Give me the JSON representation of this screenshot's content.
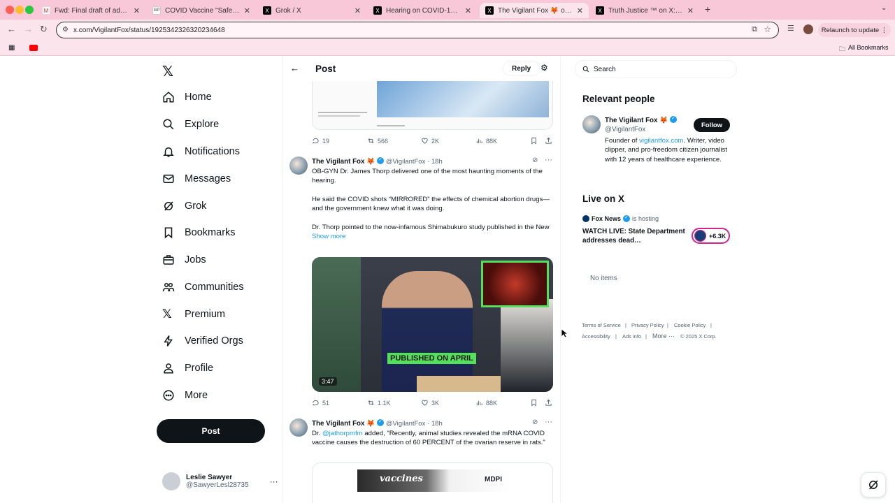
{
  "browser": {
    "tabs": [
      {
        "label": "Fwd: Final draft of advertisem",
        "icon": "gmail-icon"
      },
      {
        "label": "COVID Vaccine \"Safe and Effe",
        "icon": "gp-icon"
      },
      {
        "label": "Grok / X",
        "icon": "x-icon"
      },
      {
        "label": "Hearing on COVID-19 Vaccin",
        "icon": "x-icon"
      },
      {
        "label": "The Vigilant Fox 🦊 on X: \"Se",
        "icon": "x-icon"
      },
      {
        "label": "Truth Justice ™ on X: \"@Pete",
        "icon": "x-icon"
      }
    ],
    "url": "x.com/VigilantFox/status/1925342326320234648",
    "relaunch": "Relaunch to update",
    "all_bookmarks": "All Bookmarks"
  },
  "nav": {
    "items": [
      "Home",
      "Explore",
      "Notifications",
      "Messages",
      "Grok",
      "Bookmarks",
      "Jobs",
      "Communities",
      "Premium",
      "Verified Orgs",
      "Profile",
      "More"
    ],
    "post_button": "Post",
    "account": {
      "name": "Leslie Sawyer",
      "handle": "@SawyerLesl28735"
    }
  },
  "main": {
    "title": "Post",
    "reply": "Reply",
    "top_actions": {
      "replies": "19",
      "reposts": "566",
      "likes": "2K",
      "views": "88K"
    },
    "tweet1": {
      "author": "The Vigilant Fox 🦊",
      "handle": "@VigilantFox",
      "time": "· 18h",
      "p1": "OB-GYN Dr. James Thorp delivered one of the most haunting moments of the hearing.",
      "p2": "He said the COVID shots “MIRRORED” the effects of chemical abortion drugs—and the government knew what it was doing.",
      "p3": "Dr. Thorp pointed to the now-infamous Shimabukuro study published in the New",
      "show_more": "Show more",
      "video_caption": "PUBLISHED ON APRIL",
      "duration": "3:47",
      "actions": {
        "replies": "51",
        "reposts": "1.1K",
        "likes": "3K",
        "views": "88K"
      }
    },
    "tweet2": {
      "author": "The Vigilant Fox 🦊",
      "handle": "@VigilantFox",
      "time": "· 18h",
      "pre": "Dr. ",
      "mention": "@jathorpmfm",
      "post": " added, \"Recently, animal studies revealed the mRNA COVID vaccine causes the destruction of 60 PERCENT of the ovarian reserve in rats.\"",
      "image_text": "vaccines",
      "image_logo": "MDPI"
    }
  },
  "right": {
    "search_placeholder": "Search",
    "relevant_title": "Relevant people",
    "person": {
      "name": "The Vigilant Fox 🦊",
      "handle": "@VigilantFox",
      "follow": "Follow",
      "bio_pre": "Founder of ",
      "bio_link": "vigilantfox.com",
      "bio_post": ". Writer, video clipper, and pro-freedom citizen journalist with 12 years of healthcare experience."
    },
    "live_title": "Live on X",
    "live": {
      "host": "Fox News",
      "status": "is hosting",
      "title": "WATCH LIVE: State Department addresses dead…",
      "count": "+6.3K"
    },
    "no_items": "No items",
    "footer": [
      "Terms of Service",
      "Privacy Policy",
      "Cookie Policy",
      "Accessibility",
      "Ads info",
      "More ···",
      "© 2025 X Corp."
    ]
  },
  "colors": {
    "accent": "#1d9bf0",
    "chrome": "#f8c7d8",
    "text": "#0f1419",
    "muted": "#536471"
  }
}
